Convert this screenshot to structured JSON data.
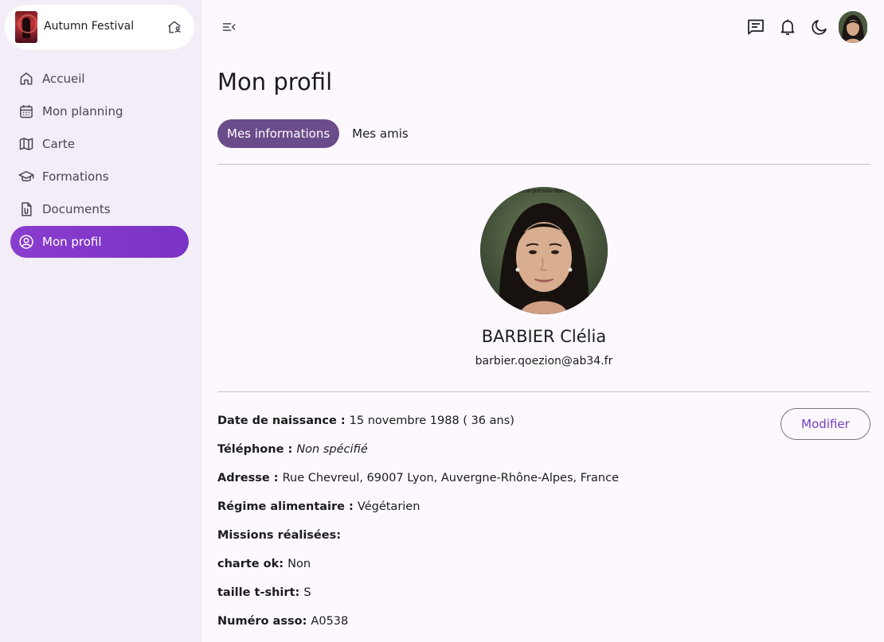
{
  "app": {
    "name": "Autumn Festival",
    "logo_icon": "festival-logo",
    "switch_icon": "home-person-icon"
  },
  "sidebar": {
    "items": [
      {
        "label": "Accueil",
        "icon": "home-icon",
        "active": false
      },
      {
        "label": "Mon planning",
        "icon": "calendar-icon",
        "active": false
      },
      {
        "label": "Carte",
        "icon": "map-icon",
        "active": false
      },
      {
        "label": "Formations",
        "icon": "graduation-cap-icon",
        "active": false
      },
      {
        "label": "Documents",
        "icon": "document-clip-icon",
        "active": false
      },
      {
        "label": "Mon profil",
        "icon": "account-circle-icon",
        "active": true
      }
    ]
  },
  "topbar": {
    "menu_icon": "menu-collapse-icon",
    "icons": [
      "chat-icon",
      "bell-icon",
      "moon-icon"
    ],
    "avatar": "user-avatar"
  },
  "page": {
    "title": "Mon profil",
    "tabs": [
      {
        "label": "Mes informations",
        "active": true
      },
      {
        "label": "Mes amis",
        "active": false
      }
    ]
  },
  "profile": {
    "photo_caption": "this-person-does",
    "name": "BARBIER Clélia",
    "email": "barbier.qoezion@ab34.fr",
    "edit_label": "Modifier",
    "fields": [
      {
        "label": "Date de naissance :",
        "value": "15 novembre 1988 ( 36 ans)",
        "italic": false
      },
      {
        "label": "Téléphone :",
        "value": "Non spécifié",
        "italic": true
      },
      {
        "label": "Adresse :",
        "value": "Rue Chevreul, 69007 Lyon, Auvergne-Rhône-Alpes, France",
        "italic": false
      },
      {
        "label": "Régime alimentaire :",
        "value": "Végétarien",
        "italic": false
      },
      {
        "label": "Missions réalisées:",
        "value": "",
        "italic": false
      },
      {
        "label": "charte ok:",
        "value": "Non",
        "italic": false
      },
      {
        "label": "taille t-shirt:",
        "value": "S",
        "italic": false
      },
      {
        "label": "Numéro asso:",
        "value": "A0538",
        "italic": false
      }
    ]
  },
  "colors": {
    "accent": "#7a33c4",
    "tab_active": "#6b4c8a",
    "sidebar_bg": "#f3edf7",
    "page_bg": "#fdf8fd"
  }
}
